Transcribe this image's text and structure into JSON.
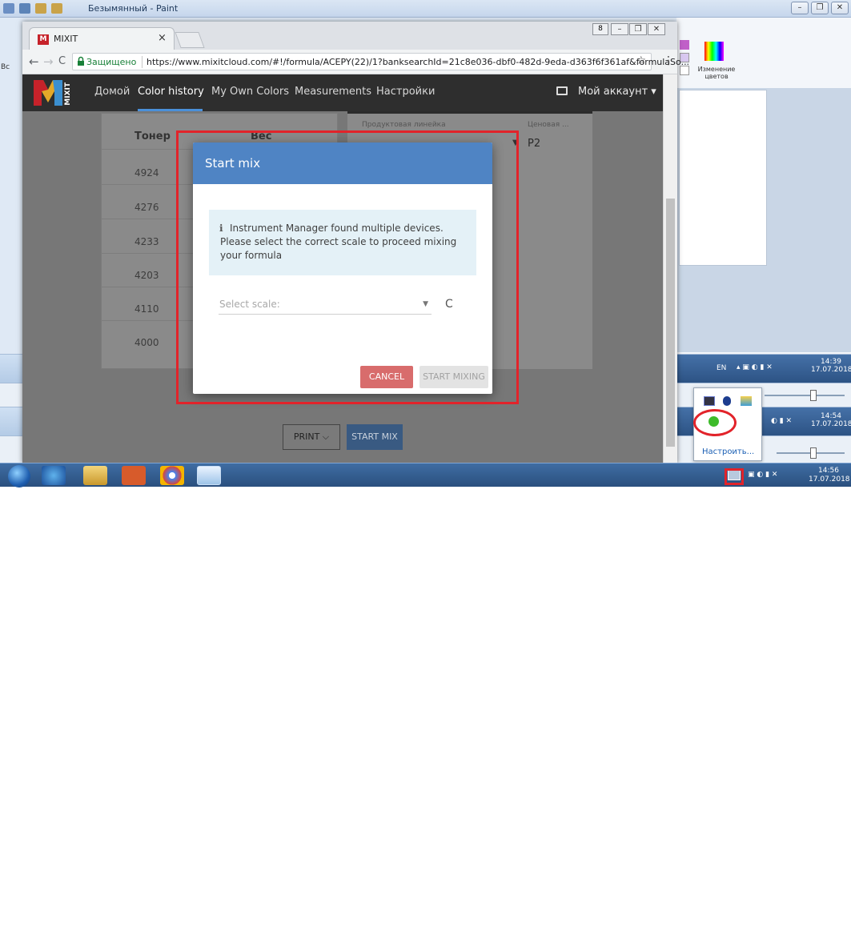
{
  "paint": {
    "title": "Безымянный - Paint",
    "edit_colors_label": "Изменение цветов",
    "left_cut_label": "Вс"
  },
  "browser": {
    "tab_favicon": "M",
    "tab_title": "MIXIT",
    "tab_close": "×",
    "secure_label": "Защищено",
    "url": "https://www.mixitcloud.com/#!/formula/ACEPY(22)/1?banksearchId=21c8e036-dbf0-482d-9eda-d363f6f361af&formulaSo...",
    "star_icon": "☆",
    "menu_icon": "⋮",
    "back_icon": "←",
    "forward_icon": "→",
    "reload_icon": "C"
  },
  "site": {
    "logo_text": "MIXIT",
    "nav": [
      "Домой",
      "Color history",
      "My Own Colors",
      "Measurements",
      "Настройки"
    ],
    "account": "Мой аккаунт ▾",
    "table": {
      "headers": [
        "Тонер",
        "Вес"
      ],
      "rows": [
        "4924",
        "4276",
        "4233",
        "4203",
        "4110",
        "4000"
      ]
    },
    "right_card": {
      "label1": "Продуктовая линейка",
      "label2": "Ценовая ...",
      "value2": "P2"
    },
    "print_label": "PRINT ⌵",
    "start_mix_label": "START MIX"
  },
  "dialog": {
    "title": "Start mix",
    "info_icon": "ℹ",
    "message": "Instrument Manager found multiple devices. Please select the correct scale to proceed mixing your formula",
    "select_placeholder": "Select scale:",
    "refresh_icon": "C",
    "cancel_label": "CANCEL",
    "start_mixing_label": "START MIXING"
  },
  "tray": {
    "lang": "EN",
    "clocks": [
      {
        "time": "14:39",
        "date": "17.07.2018"
      },
      {
        "time": "14:54",
        "date": "17.07.2018"
      },
      {
        "time": "14:56",
        "date": "17.07.2018"
      }
    ],
    "popup_customize": "Настроить..."
  },
  "colors": {
    "accent": "#4f84c4",
    "cancel": "#d86c6c",
    "annotation": "#e2232a"
  }
}
